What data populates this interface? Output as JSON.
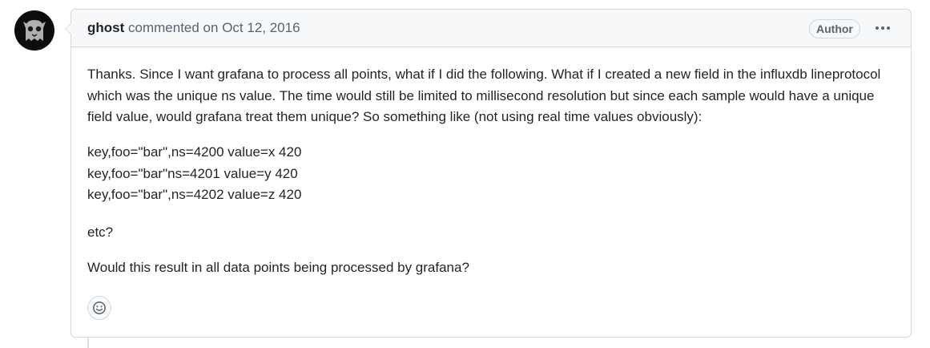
{
  "comment": {
    "author": "ghost",
    "action": "commented on",
    "date": "Oct 12, 2016",
    "badge": "Author",
    "avatar_icon": "ghost-avatar-icon",
    "menu_icon": "kebab-horizontal-icon",
    "reaction_icon": "smiley-icon",
    "body": {
      "paragraph_1": "Thanks. Since I want grafana to process all points, what if I did the following. What if I created a new field in the influxdb lineprotocol which was the unique ns value. The time would still be limited to millisecond resolution but since each sample would have a unique field value, would grafana treat them unique? So something like (not using real time values obviously):",
      "lines": [
        "key,foo=\"bar\",ns=4200 value=x 420",
        "key,foo=\"bar\"ns=4201 value=y 420",
        "key,foo=\"bar\",ns=4202 value=z 420"
      ],
      "paragraph_3": "etc?",
      "paragraph_4": "Would this result in all data points being processed by grafana?"
    }
  }
}
